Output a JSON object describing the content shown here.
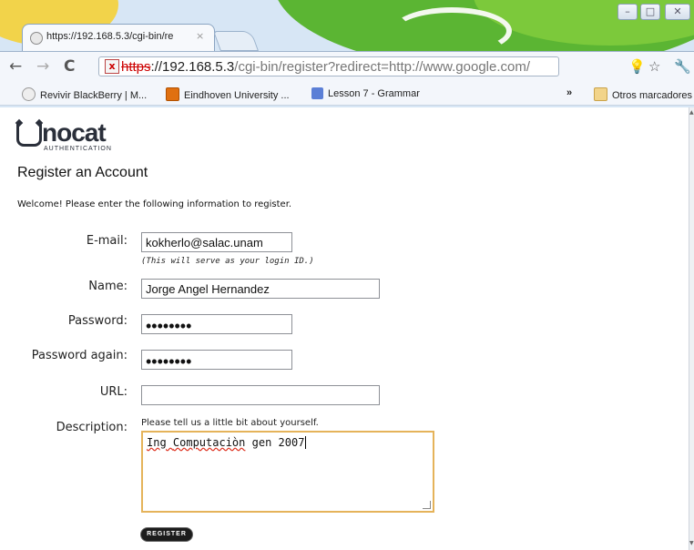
{
  "browser": {
    "tab_title": "https://192.168.5.3/cgi-bin/re",
    "tab_close": "×",
    "url_protocol": "https",
    "url_host": "://192.168.5.3",
    "url_path": "/cgi-bin/register?redirect=http://www.google.com/",
    "overflow_chevron": "»",
    "bookmarks": [
      {
        "label": "Revivir BlackBerry | M...",
        "icon": "globe-icon"
      },
      {
        "label": "Eindhoven University ...",
        "icon": "eindhoven-icon"
      },
      {
        "label": "Lesson 7 - Grammar",
        "icon": "book-icon"
      }
    ],
    "other_bookmarks": "Otros marcadores"
  },
  "page": {
    "logo_word": "nocat",
    "logo_sub": "AUTHENTICATION",
    "title": "Register an Account",
    "welcome": "Welcome! Please enter the following information to register.",
    "form": {
      "email_label": "E-mail:",
      "email_value": "kokherlo@salac.unam",
      "email_hint": "(This will serve as your login ID.)",
      "name_label": "Name:",
      "name_value": "Jorge Angel Hernandez",
      "password_label": "Password:",
      "password_value": "••••••••",
      "password_again_label": "Password again:",
      "password_again_value": "••••••••",
      "url_label": "URL:",
      "url_value": "",
      "description_label": "Description:",
      "description_hint": "Please tell us a little bit about yourself.",
      "description_value_part1": "Ing ",
      "description_value_part2": "Computaciòn",
      "description_value_part3": " gen 2007",
      "register_button": "REGISTER"
    }
  },
  "colors": {
    "textarea_focus": "#e5b35a",
    "insecure_protocol": "#cc0000"
  }
}
